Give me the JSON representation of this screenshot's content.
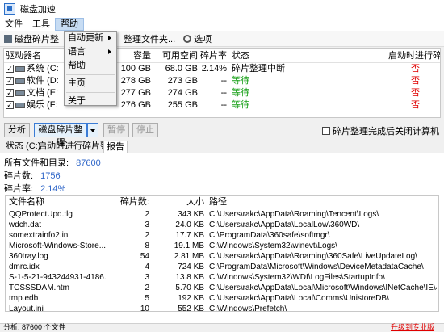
{
  "window": {
    "title": "磁盘加速"
  },
  "menubar": {
    "items": [
      "文件",
      "工具",
      "帮助"
    ]
  },
  "toolbar": {
    "items": [
      "磁盘碎片整",
      "整理文件夹...",
      "选项"
    ]
  },
  "help_menu": {
    "items": [
      "自动更新",
      "语言",
      "帮助",
      "主页",
      "关于"
    ]
  },
  "drives": {
    "columns": [
      "驱动器名",
      "容量",
      "可用空间",
      "碎片率",
      "状态",
      "启动时进行碎..."
    ],
    "rows": [
      {
        "name": "系统 (C:",
        "capacity": "100 GB",
        "free": "68.0 GB",
        "frag": "2.14%",
        "status": "碎片整理中断",
        "boot": "否",
        "checked": true
      },
      {
        "name": "软件 (D:",
        "capacity": "278 GB",
        "free": "273 GB",
        "frag": "--",
        "status": "等待",
        "boot": "否",
        "checked": true
      },
      {
        "name": "文档 (E:",
        "capacity": "277 GB",
        "free": "274 GB",
        "frag": "--",
        "status": "等待",
        "boot": "否",
        "checked": true
      },
      {
        "name": "娱乐 (F:",
        "capacity": "276 GB",
        "free": "255 GB",
        "frag": "--",
        "status": "等待",
        "boot": "否",
        "checked": true
      }
    ]
  },
  "actions": {
    "analyze": "分析",
    "defrag": "磁盘碎片整理",
    "pause": "暂停",
    "stop": "停止",
    "shutdown_option": "碎片整理完成后关闭计算机"
  },
  "tabs": [
    "状态 (C:)",
    "启动时进行碎片整理",
    "报告"
  ],
  "report": {
    "all_files_label": "所有文件和目录:",
    "all_files_value": "87600",
    "fragments_label": "碎片数:",
    "fragments_value": "1756",
    "frag_rate_label": "碎片率:",
    "frag_rate_value": "2.14%",
    "columns": [
      "文件名称",
      "碎片数:",
      "大小",
      "路径"
    ],
    "files": [
      {
        "name": "QQProtectUpd.tlg",
        "frags": "2",
        "size": "343 KB",
        "path": "C:\\Users\\rakc\\AppData\\Roaming\\Tencent\\Logs\\"
      },
      {
        "name": "wdch.dat",
        "frags": "3",
        "size": "24.0 KB",
        "path": "C:\\Users\\rakc\\AppData\\LocalLow\\360WD\\"
      },
      {
        "name": "somextrainfo2.ini",
        "frags": "2",
        "size": "17.7 KB",
        "path": "C:\\ProgramData\\360safe\\softmgr\\"
      },
      {
        "name": "Microsoft-Windows-Store...",
        "frags": "8",
        "size": "19.1 MB",
        "path": "C:\\Windows\\System32\\winevt\\Logs\\"
      },
      {
        "name": "360tray.log",
        "frags": "54",
        "size": "2.81 MB",
        "path": "C:\\Users\\rakc\\AppData\\Roaming\\360Safe\\LiveUpdateLog\\"
      },
      {
        "name": "dmrc.idx",
        "frags": "4",
        "size": "724 KB",
        "path": "C:\\ProgramData\\Microsoft\\Windows\\DeviceMetadataCache\\"
      },
      {
        "name": "S-1-5-21-943244931-4186...",
        "frags": "3",
        "size": "13.8 KB",
        "path": "C:\\Windows\\System32\\WDI\\LogFiles\\StartupInfo\\"
      },
      {
        "name": "TCSSSDAM.htm",
        "frags": "2",
        "size": "5.70 KB",
        "path": "C:\\Users\\rakc\\AppData\\Local\\Microsoft\\Windows\\INetCache\\IE\\4GTN4XFV\\"
      },
      {
        "name": "tmp.edb",
        "frags": "5",
        "size": "192 KB",
        "path": "C:\\Users\\rakc\\AppData\\Local\\Comms\\UnistoreDB\\"
      },
      {
        "name": "Layout.ini",
        "frags": "10",
        "size": "552 KB",
        "path": "C:\\Windows\\Prefetch\\"
      }
    ]
  },
  "statusbar": {
    "text": "分析: 87600 个文件",
    "upgrade": "升级到专业版"
  }
}
